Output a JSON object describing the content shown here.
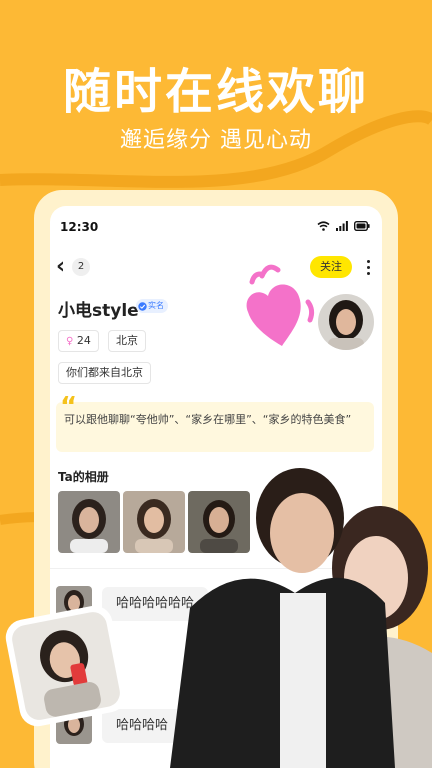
{
  "headline": "随时在线欢聊",
  "subheadline": "邂逅缘分 遇见心动",
  "status_bar": {
    "time": "12:30"
  },
  "nav": {
    "back_count": "2",
    "follow_label": "关注"
  },
  "profile": {
    "username": "小电style",
    "verified_label": "实名",
    "age_tag": "24",
    "city_tag": "北京",
    "common_tag": "你们都来自北京",
    "quote": "可以跟他聊聊“夸他帅”、“家乡在哪里”、“家乡的特色美食”"
  },
  "album": {
    "title": "Ta的相册"
  },
  "chat": {
    "messages": [
      "哈哈哈哈哈哈",
      "哈哈哈哈"
    ]
  },
  "colors": {
    "brand_yellow": "#FDB935",
    "follow_yellow": "#FFE600",
    "heart_pink": "#F472C9",
    "verified_blue": "#3B7BFF"
  }
}
